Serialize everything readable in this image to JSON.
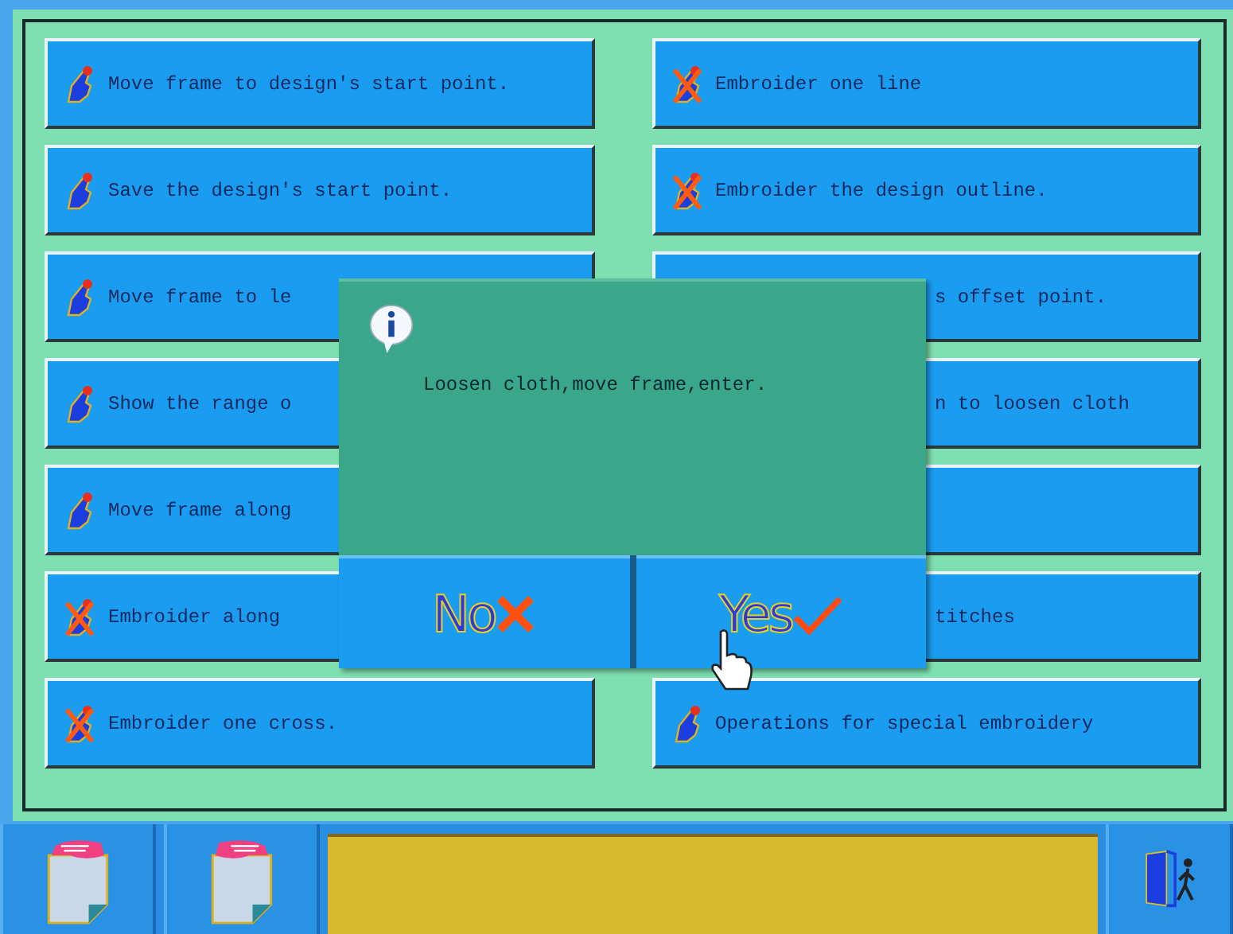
{
  "left_buttons": [
    {
      "kind": "hand",
      "label": "Move frame to design's start point."
    },
    {
      "kind": "hand",
      "label": "Save the design's start point."
    },
    {
      "kind": "hand",
      "label": "Move frame to le"
    },
    {
      "kind": "hand",
      "label": "Show the range o"
    },
    {
      "kind": "hand",
      "label": "Move frame along"
    },
    {
      "kind": "cross",
      "label": "Embroider along"
    },
    {
      "kind": "cross",
      "label": "Embroider one cross."
    }
  ],
  "right_buttons": [
    {
      "kind": "cross",
      "label": "Embroider one line"
    },
    {
      "kind": "cross",
      "label": "Embroider the design outline."
    },
    {
      "kind": "covered",
      "label": "s offset point."
    },
    {
      "kind": "covered",
      "label": "n to loosen cloth"
    },
    {
      "kind": "covered"
    },
    {
      "kind": "covered",
      "label": "titches"
    },
    {
      "kind": "hand",
      "label": "Operations for special embroidery"
    }
  ],
  "dialog": {
    "message": "Loosen cloth,move frame,enter.",
    "buttons": [
      {
        "kind": "no",
        "label": "No"
      },
      {
        "kind": "yes",
        "label": "Yes"
      }
    ]
  },
  "bottom_bar": {
    "buttons": [
      {
        "kind": "prev"
      },
      {
        "kind": "next"
      }
    ]
  }
}
